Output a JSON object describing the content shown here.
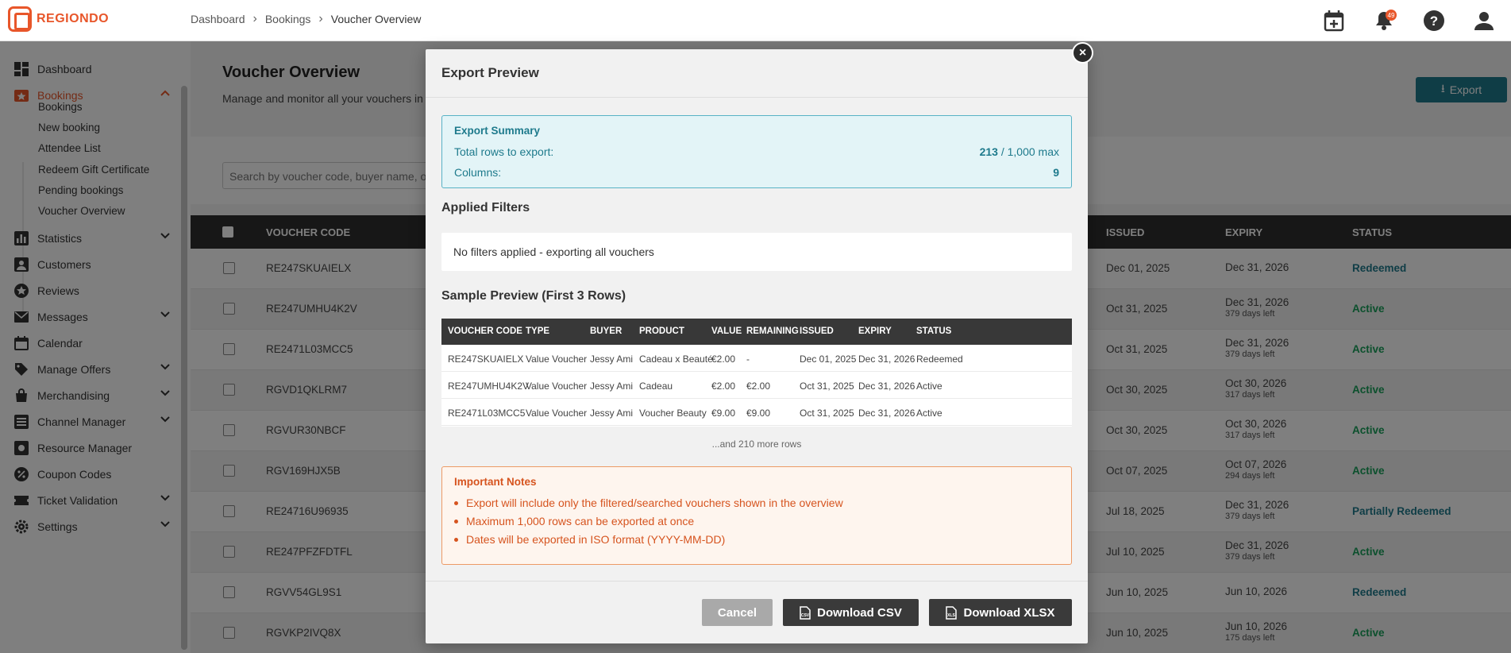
{
  "brand": {
    "name": "REGIONDO",
    "color": "#e8562a"
  },
  "breadcrumb": [
    "Dashboard",
    "Bookings",
    "Voucher Overview"
  ],
  "header": {
    "notification_count": "49"
  },
  "sidebar": {
    "items": [
      {
        "label": "Dashboard",
        "icon": "dashboard-icon"
      },
      {
        "label": "Bookings",
        "icon": "bookings-icon",
        "active": true
      },
      {
        "label": "Statistics",
        "icon": "statistics-icon"
      },
      {
        "label": "Customers",
        "icon": "customers-icon"
      },
      {
        "label": "Reviews",
        "icon": "reviews-icon"
      },
      {
        "label": "Messages",
        "icon": "messages-icon"
      },
      {
        "label": "Calendar",
        "icon": "calendar-icon"
      },
      {
        "label": "Manage Offers",
        "icon": "tag-icon"
      },
      {
        "label": "Merchandising",
        "icon": "bag-icon"
      },
      {
        "label": "Channel Manager",
        "icon": "channel-icon"
      },
      {
        "label": "Resource Manager",
        "icon": "resource-icon"
      },
      {
        "label": "Coupon Codes",
        "icon": "percent-icon"
      },
      {
        "label": "Ticket Validation",
        "icon": "ticket-icon"
      },
      {
        "label": "Settings",
        "icon": "gear-icon"
      }
    ],
    "sub_items": [
      "Bookings",
      "New booking",
      "Attendee List",
      "Redeem Gift Certificate",
      "Pending bookings",
      "Voucher Overview"
    ]
  },
  "page": {
    "title": "Voucher Overview",
    "subtitle": "Manage and monitor all your vouchers in",
    "export_label": "Export",
    "search_placeholder": "Search by voucher code, buyer name, or"
  },
  "table": {
    "headers": {
      "code": "VOUCHER CODE",
      "issued": "ISSUED",
      "expiry": "EXPIRY",
      "status": "STATUS"
    },
    "rows": [
      {
        "code": "RE247SKUAIELX",
        "issued": "Dec 01, 2025",
        "expiry": "Dec 31, 2026",
        "left": "",
        "status": "Redeemed"
      },
      {
        "code": "RE247UMHU4K2V",
        "issued": "Oct 31, 2025",
        "expiry": "Dec 31, 2026",
        "left": "379 days left",
        "status": "Active"
      },
      {
        "code": "RE2471L03MCC5",
        "issued": "Oct 31, 2025",
        "expiry": "Dec 31, 2026",
        "left": "379 days left",
        "status": "Active"
      },
      {
        "code": "RGVD1QKLRM7",
        "issued": "Oct 30, 2025",
        "expiry": "Oct 30, 2026",
        "left": "317 days left",
        "status": "Active"
      },
      {
        "code": "RGVUR30NBCF",
        "issued": "Oct 30, 2025",
        "expiry": "Oct 30, 2026",
        "left": "317 days left",
        "status": "Active"
      },
      {
        "code": "RGV169HJX5B",
        "issued": "Oct 07, 2025",
        "expiry": "Oct 07, 2026",
        "left": "294 days left",
        "status": "Active"
      },
      {
        "code": "RE24716U96935",
        "issued": "Jul 18, 2025",
        "expiry": "Dec 31, 2026",
        "left": "379 days left",
        "status": "Partially Redeemed"
      },
      {
        "code": "RE247PFZFDTFL",
        "issued": "Jul 10, 2025",
        "expiry": "Dec 31, 2026",
        "left": "379 days left",
        "status": "Active"
      },
      {
        "code": "RGVV54GL9S1",
        "issued": "Jun 10, 2025",
        "expiry": "Jun 10, 2026",
        "left": "",
        "status": "Redeemed"
      },
      {
        "code": "RGVKP2IVQ8X",
        "issued": "Jun 10, 2025",
        "expiry": "Jun 10, 2026",
        "left": "175 days left",
        "status": "Active"
      }
    ]
  },
  "modal": {
    "title": "Export Preview",
    "summary": {
      "title": "Export Summary",
      "rows_label": "Total rows to export:",
      "rows_value": "213",
      "rows_max": "/ 1,000 max",
      "columns_label": "Columns:",
      "columns_value": "9"
    },
    "filters_title": "Applied Filters",
    "filters_text": "No filters applied - exporting all vouchers",
    "sample_title": "Sample Preview (First 3 Rows)",
    "sample_headers": [
      "VOUCHER CODE",
      "TYPE",
      "BUYER",
      "PRODUCT",
      "VALUE",
      "REMAINING",
      "ISSUED",
      "EXPIRY",
      "STATUS"
    ],
    "sample_rows": [
      [
        "RE247SKUAIELX",
        "Value Voucher",
        "Jessy Ami",
        "Cadeau x Beauté",
        "€2.00",
        "-",
        "Dec 01, 2025",
        "Dec 31, 2026",
        "Redeemed"
      ],
      [
        "RE247UMHU4K2V",
        "Value Voucher",
        "Jessy Ami",
        "Cadeau",
        "€2.00",
        "€2.00",
        "Oct 31, 2025",
        "Dec 31, 2026",
        "Active"
      ],
      [
        "RE2471L03MCC5",
        "Value Voucher",
        "Jessy Ami",
        "Voucher Beauty",
        "€9.00",
        "€9.00",
        "Oct 31, 2025",
        "Dec 31, 2026",
        "Active"
      ]
    ],
    "more_rows": "...and 210 more rows",
    "notes": {
      "title": "Important Notes",
      "items": [
        "Export will include only the filtered/searched vouchers shown in the overview",
        "Maximum 1,000 rows can be exported at once",
        "Dates will be exported in ISO format (YYYY-MM-DD)"
      ]
    },
    "buttons": {
      "cancel": "Cancel",
      "csv": "Download CSV",
      "xlsx": "Download XLSX"
    }
  }
}
